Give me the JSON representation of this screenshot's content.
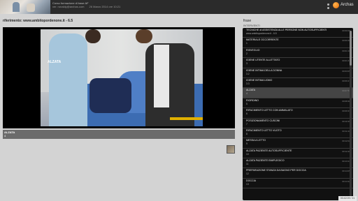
{
  "header": {
    "line1": "Corso formazione di base AF",
    "meta": [
      "ver. ronaldy@archas.com",
      "26 Marzo 2014 ore 10:21"
    ],
    "brand": "Archas"
  },
  "reference": "riferimento: www.ambitopordenone.it - 6.5",
  "video": {
    "overlay_label": "ALZATA"
  },
  "caption": {
    "title": "ALZATA",
    "number": "4"
  },
  "sidebar": {
    "title": "frase",
    "subtitle": "INTERVENTI",
    "items": [
      {
        "label": "TECNICHE di ASSISTENZA ALLE PERSONE NON AUTOSUFFICIENTI",
        "sub": "www.ambitopordenone.it - 6.5",
        "time": "00:00:00"
      },
      {
        "label": "MATERIALE OCCORRENTE",
        "sub": "1",
        "time": "00:00:46"
      },
      {
        "label": "RISVEGLIO",
        "sub": "2",
        "time": "00:01:16"
      },
      {
        "label": "IGIENE UTENTE ALLETTATO",
        "sub": "3",
        "time": "00:01:47"
      },
      {
        "label": "IGIENE INTIMA DELLA DONNA",
        "sub": "3.2",
        "time": "00:03:05"
      },
      {
        "label": "IGIENE INTIMA UOMO",
        "sub": "3.3",
        "time": "00:06:27"
      },
      {
        "label": "ALZATA",
        "sub": "4",
        "time": "00:07:53",
        "active": true
      },
      {
        "label": "RIORDINO",
        "sub": "5",
        "time": "00:08:48"
      },
      {
        "label": "RIFACIMENTO LETTO CON AMMALATO",
        "sub": "6",
        "time": "00:09:33"
      },
      {
        "label": "POSIZIONAMENTO CUSCINI",
        "sub": "7",
        "time": "00:10:35"
      },
      {
        "label": "RIFACIMENTO LETTO VUOTO",
        "sub": "8",
        "time": "00:11:10"
      },
      {
        "label": "MESSA A LETTO",
        "sub": "9",
        "time": "00:12:02"
      },
      {
        "label": "ALZATA PAZIENTE AUTOSUFFICIENTE",
        "sub": "10",
        "time": "00:12:46"
      },
      {
        "label": "ALZATA PAZIENTE EMIPLEGICO",
        "sub": "11",
        "time": "00:13:24"
      },
      {
        "label": "PREPARAZIONE STANZA DA BAGNO PER DOCCIA",
        "sub": "12",
        "time": "00:14:05"
      },
      {
        "label": "DOCCIA",
        "sub": "13",
        "time": "00:14:32"
      }
    ]
  },
  "timer": "00:42:09 / 21"
}
